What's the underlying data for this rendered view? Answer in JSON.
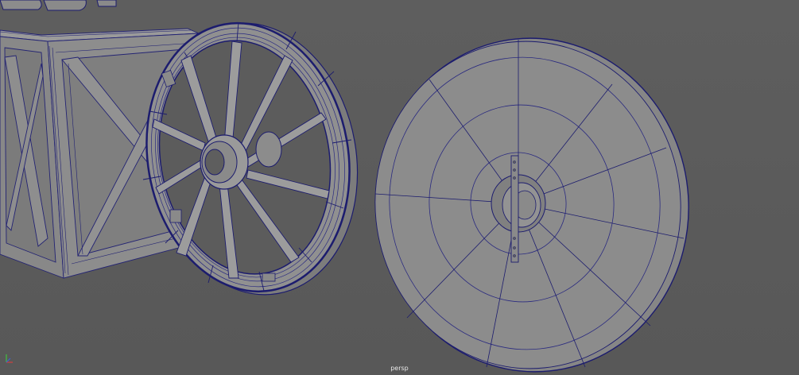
{
  "viewport": {
    "camera_label": "persp",
    "background_color": "#5b5b5b",
    "wire_color": "#1c1c6e",
    "mesh_color": "#8a8a8a"
  },
  "objects": [
    {
      "name": "crate",
      "type": "mesh"
    },
    {
      "name": "wagon-wheel",
      "type": "mesh"
    },
    {
      "name": "dish-disc",
      "type": "mesh"
    }
  ],
  "axis_gizmo": {
    "icon": "axis-icon",
    "x_color": "#d04040",
    "y_color": "#40c040",
    "z_color": "#4060d0"
  }
}
